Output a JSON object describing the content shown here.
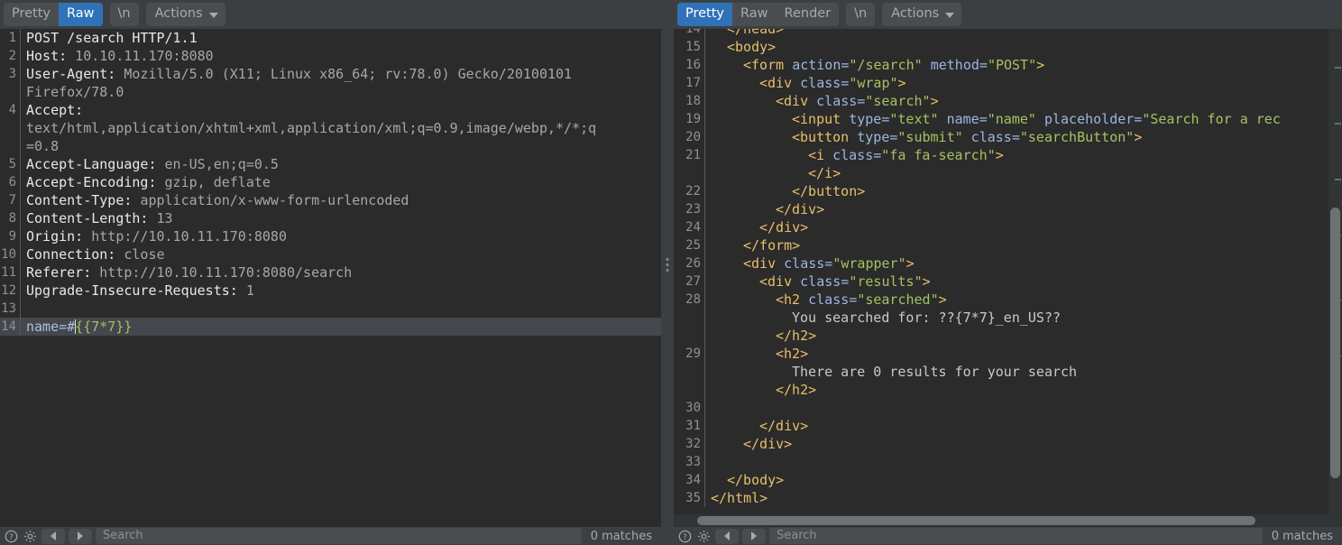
{
  "left_panel": {
    "toolbar": {
      "view_modes": [
        {
          "label": "Pretty",
          "active": false
        },
        {
          "label": "Raw",
          "active": true
        }
      ],
      "newline_label": "\\n",
      "actions_label": "Actions"
    },
    "lines": [
      {
        "num": "1",
        "tokens": [
          {
            "text": "POST /search HTTP/1.1",
            "cls": "t-hdr"
          }
        ]
      },
      {
        "num": "2",
        "tokens": [
          {
            "text": "Host: ",
            "cls": "t-hdr"
          },
          {
            "text": "10.10.11.170:8080",
            "cls": "t-val"
          }
        ]
      },
      {
        "num": "3",
        "tokens": [
          {
            "text": "User-Agent: ",
            "cls": "t-hdr"
          },
          {
            "text": "Mozilla/5.0 (X11; Linux x86_64; rv:78.0) Gecko/20100101",
            "cls": "t-val"
          }
        ]
      },
      {
        "num": "",
        "tokens": [
          {
            "text": "Firefox/78.0",
            "cls": "t-val"
          }
        ]
      },
      {
        "num": "4",
        "tokens": [
          {
            "text": "Accept: ",
            "cls": "t-hdr"
          }
        ]
      },
      {
        "num": "",
        "tokens": [
          {
            "text": "text/html,application/xhtml+xml,application/xml;q=0.9,image/webp,*/*;q",
            "cls": "t-val"
          }
        ]
      },
      {
        "num": "",
        "tokens": [
          {
            "text": "=0.8",
            "cls": "t-val"
          }
        ]
      },
      {
        "num": "5",
        "tokens": [
          {
            "text": "Accept-Language: ",
            "cls": "t-hdr"
          },
          {
            "text": "en-US,en;q=0.5",
            "cls": "t-val"
          }
        ]
      },
      {
        "num": "6",
        "tokens": [
          {
            "text": "Accept-Encoding: ",
            "cls": "t-hdr"
          },
          {
            "text": "gzip, deflate",
            "cls": "t-val"
          }
        ]
      },
      {
        "num": "7",
        "tokens": [
          {
            "text": "Content-Type: ",
            "cls": "t-hdr"
          },
          {
            "text": "application/x-www-form-urlencoded",
            "cls": "t-val"
          }
        ]
      },
      {
        "num": "8",
        "tokens": [
          {
            "text": "Content-Length: ",
            "cls": "t-hdr"
          },
          {
            "text": "13",
            "cls": "t-val"
          }
        ]
      },
      {
        "num": "9",
        "tokens": [
          {
            "text": "Origin: ",
            "cls": "t-hdr"
          },
          {
            "text": "http://10.10.11.170:8080",
            "cls": "t-val"
          }
        ]
      },
      {
        "num": "10",
        "tokens": [
          {
            "text": "Connection: ",
            "cls": "t-hdr"
          },
          {
            "text": "close",
            "cls": "t-val"
          }
        ]
      },
      {
        "num": "11",
        "tokens": [
          {
            "text": "Referer: ",
            "cls": "t-hdr"
          },
          {
            "text": "http://10.10.11.170:8080/search",
            "cls": "t-val"
          }
        ]
      },
      {
        "num": "12",
        "tokens": [
          {
            "text": "Upgrade-Insecure-Requests: ",
            "cls": "t-hdr"
          },
          {
            "text": "1",
            "cls": "t-val"
          }
        ]
      },
      {
        "num": "13",
        "tokens": []
      },
      {
        "num": "14",
        "highlighted": true,
        "tokens": [
          {
            "text": "name=#",
            "cls": "t-body"
          },
          {
            "text": "",
            "cls": "caret"
          },
          {
            "text": "{{7*7}}",
            "cls": "t-expr"
          }
        ]
      }
    ],
    "footer": {
      "search_placeholder": "Search",
      "matches_label": "0 matches"
    }
  },
  "right_panel": {
    "toolbar": {
      "view_modes": [
        {
          "label": "Pretty",
          "active": true
        },
        {
          "label": "Raw",
          "active": false
        },
        {
          "label": "Render",
          "active": false
        }
      ],
      "newline_label": "\\n",
      "actions_label": "Actions"
    },
    "lines": [
      {
        "num": "14",
        "indent": 2,
        "tokens": [
          {
            "text": "</head>",
            "cls": "h-tag"
          }
        ]
      },
      {
        "num": "15",
        "indent": 2,
        "tokens": [
          {
            "text": "<body>",
            "cls": "h-tag"
          }
        ]
      },
      {
        "num": "16",
        "indent": 4,
        "tokens": [
          {
            "text": "<form ",
            "cls": "h-tag"
          },
          {
            "text": "action=",
            "cls": "h-attr"
          },
          {
            "text": "\"/search\"",
            "cls": "h-str"
          },
          {
            "text": " method=",
            "cls": "h-attr"
          },
          {
            "text": "\"POST\"",
            "cls": "h-str"
          },
          {
            "text": ">",
            "cls": "h-tag"
          }
        ]
      },
      {
        "num": "17",
        "indent": 6,
        "tokens": [
          {
            "text": "<div ",
            "cls": "h-tag"
          },
          {
            "text": "class=",
            "cls": "h-attr"
          },
          {
            "text": "\"wrap\"",
            "cls": "h-str"
          },
          {
            "text": ">",
            "cls": "h-tag"
          }
        ]
      },
      {
        "num": "18",
        "indent": 8,
        "tokens": [
          {
            "text": "<div ",
            "cls": "h-tag"
          },
          {
            "text": "class=",
            "cls": "h-attr"
          },
          {
            "text": "\"search\"",
            "cls": "h-str"
          },
          {
            "text": ">",
            "cls": "h-tag"
          }
        ]
      },
      {
        "num": "19",
        "indent": 10,
        "tokens": [
          {
            "text": "<input ",
            "cls": "h-tag"
          },
          {
            "text": "type=",
            "cls": "h-attr"
          },
          {
            "text": "\"text\"",
            "cls": "h-str"
          },
          {
            "text": " name=",
            "cls": "h-attr"
          },
          {
            "text": "\"name\"",
            "cls": "h-str"
          },
          {
            "text": " placeholder=",
            "cls": "h-attr"
          },
          {
            "text": "\"Search for a rec",
            "cls": "h-str"
          }
        ]
      },
      {
        "num": "20",
        "indent": 10,
        "tokens": [
          {
            "text": "<button ",
            "cls": "h-tag"
          },
          {
            "text": "type=",
            "cls": "h-attr"
          },
          {
            "text": "\"submit\"",
            "cls": "h-str"
          },
          {
            "text": " class=",
            "cls": "h-attr"
          },
          {
            "text": "\"searchButton\"",
            "cls": "h-str"
          },
          {
            "text": ">",
            "cls": "h-tag"
          }
        ]
      },
      {
        "num": "21",
        "indent": 12,
        "tokens": [
          {
            "text": "<i ",
            "cls": "h-tag"
          },
          {
            "text": "class=",
            "cls": "h-attr"
          },
          {
            "text": "\"fa fa-search\"",
            "cls": "h-str"
          },
          {
            "text": ">",
            "cls": "h-tag"
          }
        ]
      },
      {
        "num": "",
        "indent": 12,
        "tokens": [
          {
            "text": "</i>",
            "cls": "h-tag"
          }
        ]
      },
      {
        "num": "22",
        "indent": 10,
        "tokens": [
          {
            "text": "</button>",
            "cls": "h-tag"
          }
        ]
      },
      {
        "num": "23",
        "indent": 8,
        "tokens": [
          {
            "text": "</div>",
            "cls": "h-tag"
          }
        ]
      },
      {
        "num": "24",
        "indent": 6,
        "tokens": [
          {
            "text": "</div>",
            "cls": "h-tag"
          }
        ]
      },
      {
        "num": "25",
        "indent": 4,
        "tokens": [
          {
            "text": "</form>",
            "cls": "h-tag"
          }
        ]
      },
      {
        "num": "26",
        "indent": 4,
        "tokens": [
          {
            "text": "<div ",
            "cls": "h-tag"
          },
          {
            "text": "class=",
            "cls": "h-attr"
          },
          {
            "text": "\"wrapper\"",
            "cls": "h-str"
          },
          {
            "text": ">",
            "cls": "h-tag"
          }
        ]
      },
      {
        "num": "27",
        "indent": 6,
        "tokens": [
          {
            "text": "<div ",
            "cls": "h-tag"
          },
          {
            "text": "class=",
            "cls": "h-attr"
          },
          {
            "text": "\"results\"",
            "cls": "h-str"
          },
          {
            "text": ">",
            "cls": "h-tag"
          }
        ]
      },
      {
        "num": "28",
        "indent": 8,
        "tokens": [
          {
            "text": "<h2 ",
            "cls": "h-tag"
          },
          {
            "text": "class=",
            "cls": "h-attr"
          },
          {
            "text": "\"searched\"",
            "cls": "h-str"
          },
          {
            "text": ">",
            "cls": "h-tag"
          }
        ]
      },
      {
        "num": "",
        "indent": 10,
        "tokens": [
          {
            "text": "You searched for: ??{7*7}_en_US??",
            "cls": "h-text"
          }
        ]
      },
      {
        "num": "",
        "indent": 8,
        "tokens": [
          {
            "text": "</h2>",
            "cls": "h-tag"
          }
        ]
      },
      {
        "num": "29",
        "indent": 8,
        "tokens": [
          {
            "text": "<h2>",
            "cls": "h-tag"
          }
        ]
      },
      {
        "num": "",
        "indent": 10,
        "tokens": [
          {
            "text": "There are 0 results for your search",
            "cls": "h-text"
          }
        ]
      },
      {
        "num": "",
        "indent": 8,
        "tokens": [
          {
            "text": "</h2>",
            "cls": "h-tag"
          }
        ]
      },
      {
        "num": "30",
        "indent": 0,
        "tokens": []
      },
      {
        "num": "31",
        "indent": 6,
        "tokens": [
          {
            "text": "</div>",
            "cls": "h-tag"
          }
        ]
      },
      {
        "num": "32",
        "indent": 4,
        "tokens": [
          {
            "text": "</div>",
            "cls": "h-tag"
          }
        ]
      },
      {
        "num": "33",
        "indent": 0,
        "tokens": []
      },
      {
        "num": "34",
        "indent": 2,
        "tokens": [
          {
            "text": "</body>",
            "cls": "h-tag"
          }
        ]
      },
      {
        "num": "35",
        "indent": 0,
        "tokens": [
          {
            "text": "</html>",
            "cls": "h-tag"
          }
        ]
      }
    ],
    "footer": {
      "search_placeholder": "Search",
      "matches_label": "0 matches"
    }
  },
  "colors": {
    "accent": "#2f72b8",
    "panel_bg": "#2b2b2b",
    "chrome_bg": "#3c3f41",
    "highlight_line": "#44474d",
    "tag": "#e8bf6a",
    "attr": "#9cb6e0",
    "string": "#a5c261"
  }
}
